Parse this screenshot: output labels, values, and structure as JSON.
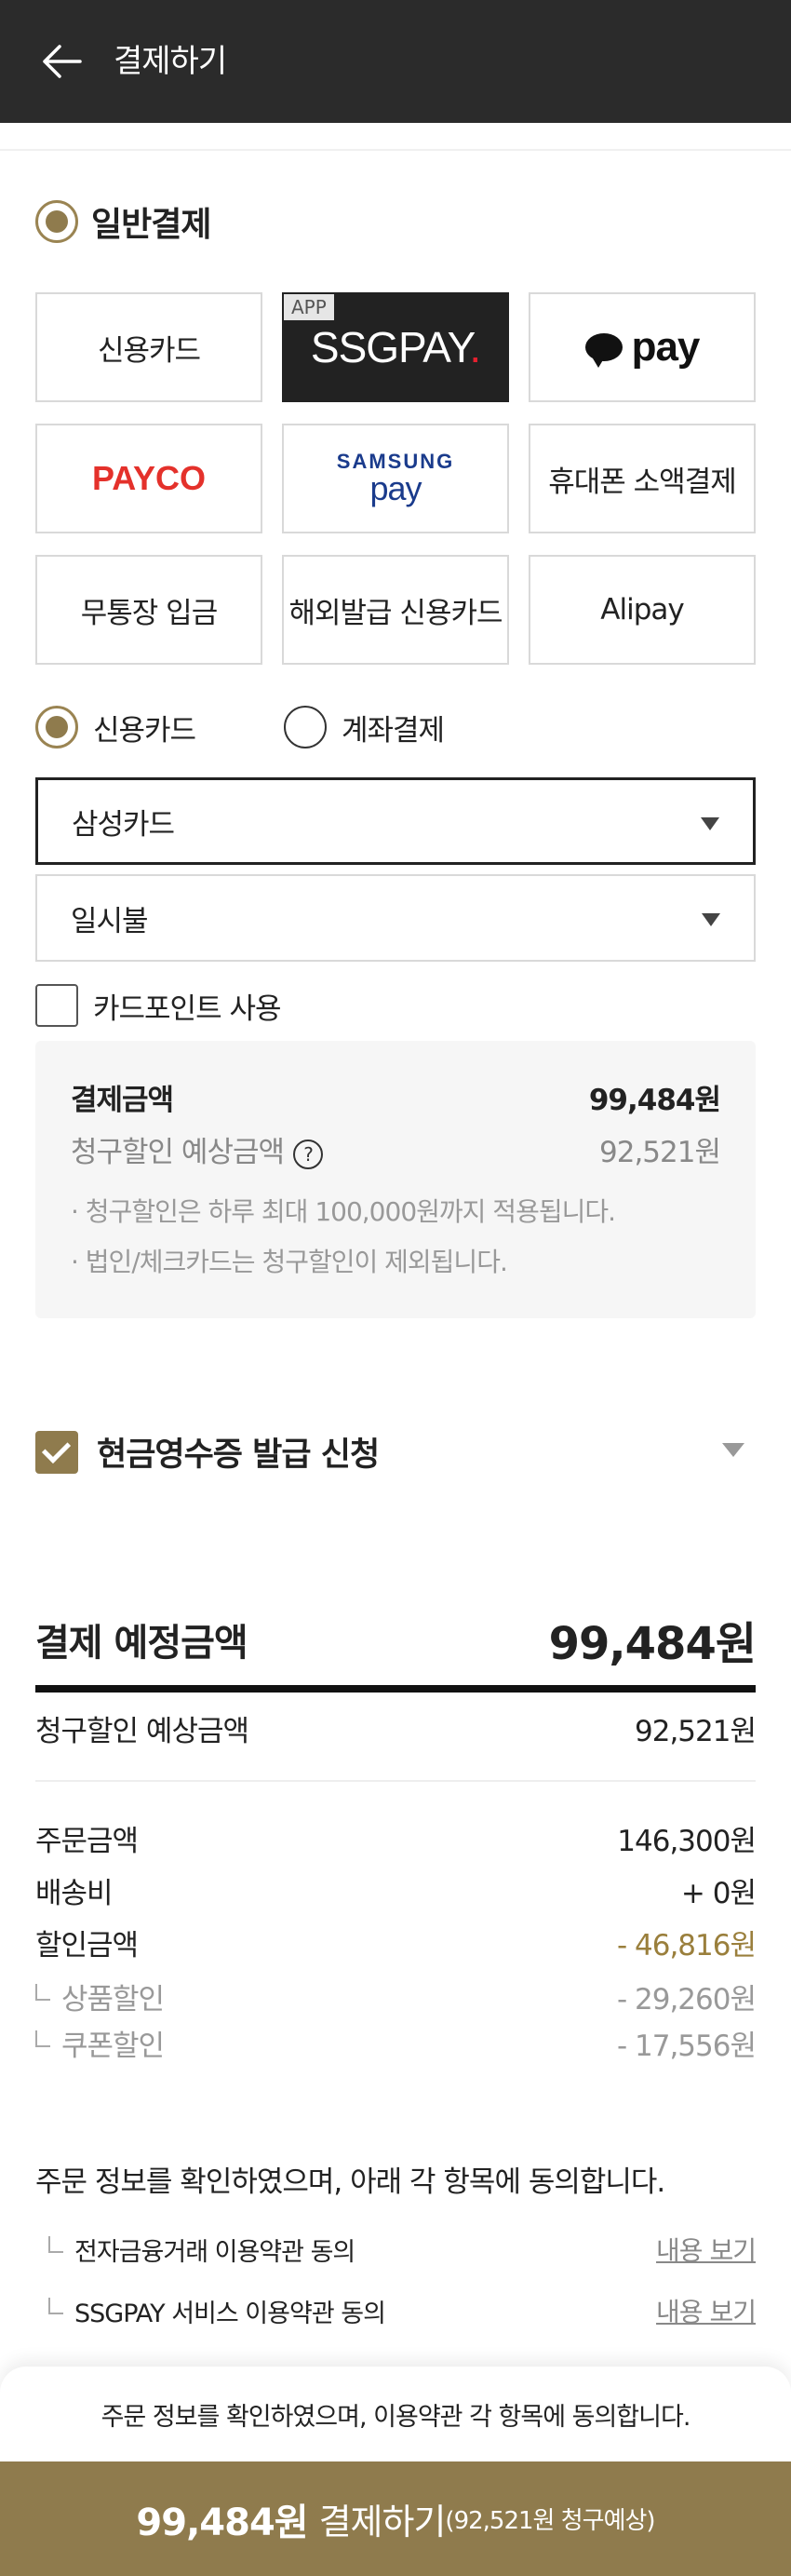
{
  "header": {
    "title": "결제하기",
    "back_icon": "arrow-left-icon"
  },
  "payment": {
    "section_title": "일반결제",
    "methods": {
      "credit_card": "신용카드",
      "ssgpay_tag": "APP",
      "ssgpay_logo": "SSGPAY",
      "ssgpay_logo_dot": ".",
      "kakaopay": "pay",
      "payco": "PAYCO",
      "samsung_top": "SAMSUNG",
      "samsung_bottom": "pay",
      "mobile": "휴대폰 소액결제",
      "bank_deposit": "무통장 입금",
      "overseas_card": "해외발급 신용카드",
      "alipay": "Alipay"
    },
    "card_types": {
      "credit": "신용카드",
      "account": "계좌결제"
    },
    "card_select": "삼성카드",
    "installment_select": "일시불",
    "card_point_label": "카드포인트 사용"
  },
  "info_box": {
    "pay_amount_label": "결제금액",
    "pay_amount_value": "99,484원",
    "expected_label": "청구할인 예상금액",
    "expected_value": "92,521원",
    "help_icon": "?",
    "note1": "· 청구할인은 하루 최대 100,000원까지 적용됩니다.",
    "note2": "· 법인/체크카드는 청구할인이 제외됩니다."
  },
  "receipt": {
    "label": "현금영수증 발급 신청"
  },
  "summary": {
    "title": "결제 예정금액",
    "total": "99,484원",
    "expected_label": "청구할인 예상금액",
    "expected_value": "92,521원",
    "order_label": "주문금액",
    "order_value": "146,300원",
    "shipping_label": "배송비",
    "shipping_value": "+ 0원",
    "discount_label": "할인금액",
    "discount_value": "- 46,816원",
    "product_discount_label": "상품할인",
    "product_discount_value": "- 29,260원",
    "coupon_discount_label": "쿠폰할인",
    "coupon_discount_value": "- 17,556원"
  },
  "terms": {
    "agree_text": "주문 정보를 확인하였으며, 아래 각 항목에 동의합니다.",
    "items": [
      {
        "label": "전자금융거래 이용약관 동의",
        "link": "내용 보기"
      },
      {
        "label": "SSGPAY 서비스 이용약관 동의",
        "link": "내용 보기"
      }
    ]
  },
  "footer": {
    "sheet_text": "주문 정보를 확인하였으며, 이용약관 각 항목에 동의합니다.",
    "pay_amount": "99,484원",
    "pay_label": "결제하기",
    "pay_sub": "(92,521원 청구예상)"
  },
  "colors": {
    "accent": "#8f7b4d",
    "header": "#2b2b2b",
    "discount": "#9a7f3c"
  }
}
